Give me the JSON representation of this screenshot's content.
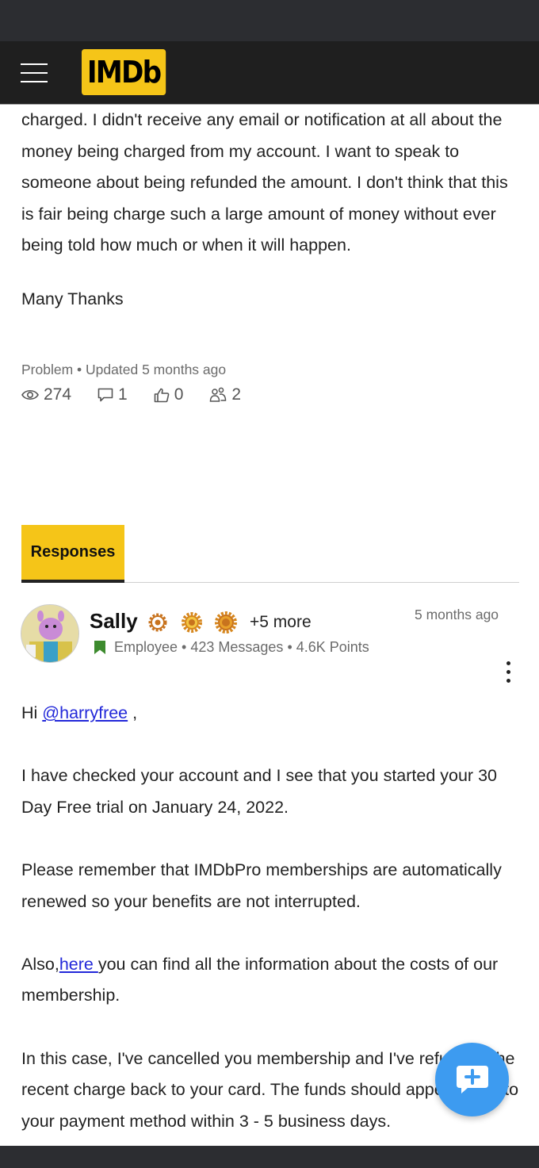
{
  "header": {
    "logo_text": "IMDb",
    "brand_color": "#f5c518"
  },
  "question": {
    "body_paragraph": "charged. I didn't receive any email or notification at all about the money being charged from my account. I want to speak to someone about being refunded the amount. I don't think that this is fair being charge such a large amount of money without ever being told how much or when it will happen.",
    "signoff": "Many Thanks",
    "type": "Problem",
    "updated": "Updated 5 months ago",
    "stats": {
      "views": "274",
      "comments": "1",
      "likes": "0",
      "followers": "2"
    }
  },
  "tabs": [
    {
      "label": "Responses",
      "active": true
    }
  ],
  "response": {
    "author": "Sally",
    "more_ranks": "+5 more",
    "time": "5 months ago",
    "role": "Employee",
    "messages": "423 Messages",
    "points": "4.6K Points",
    "greeting_prefix": "Hi ",
    "mention": "@harryfree",
    "greeting_suffix": " ,",
    "p1": "I have checked your account and I see that you started your 30 Day Free trial on January 24, 2022.",
    "p2": "Please remember that IMDbPro memberships are automatically renewed so  your benefits are not interrupted.",
    "p3_prefix": "Also,",
    "p3_link": "here ",
    "p3_suffix": "you can find all the information about the costs of our membership.",
    "p4": "In this case, I've cancelled you membership and I've refunded the recent charge back to your card. The funds should appear back to your payment method within 3 - 5 business days."
  },
  "icons": {
    "views": "eye-icon",
    "comments": "comment-icon",
    "likes": "thumbs-up-icon",
    "followers": "followers-icon",
    "rank": "sun-badge-icon",
    "role": "bookmark-icon",
    "menu": "kebab-menu-icon",
    "fab": "add-comment-icon"
  },
  "colors": {
    "fab": "#3d9bf0",
    "rank_badge": "#c8731e",
    "role_badge": "#3d8b2e",
    "link": "#2228d9"
  }
}
